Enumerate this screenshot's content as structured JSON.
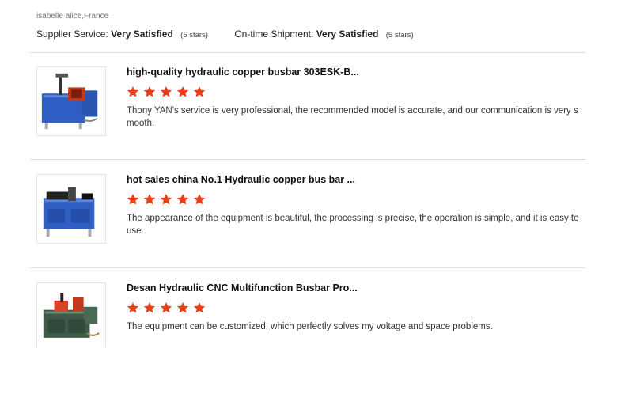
{
  "reviewer": "isabelle alice,France",
  "ratings": {
    "supplier_label": "Supplier Service:",
    "supplier_value": "Very Satisfied",
    "supplier_stars": "(5 stars)",
    "shipment_label": "On-time Shipment:",
    "shipment_value": "Very Satisfied",
    "shipment_stars": "(5 stars)"
  },
  "colors": {
    "star": "#e8411a",
    "divider": "#dedede"
  },
  "reviews": [
    {
      "title": "high-quality hydraulic copper busbar 303ESK-B...",
      "rating": 5,
      "comment": "Thony YAN's service is very professional, the recommended model is accurate, and our communication is very smooth.",
      "image_icon": "blue-busbar-machine-photo"
    },
    {
      "title": "hot sales china No.1 Hydraulic copper bus bar ...",
      "rating": 5,
      "comment": "The appearance of the equipment is beautiful, the processing is precise, the operation is simple, and it is easy to use.",
      "image_icon": "blue-busbar-machine-photo"
    },
    {
      "title": "Desan Hydraulic CNC Multifunction Busbar Pro...",
      "rating": 5,
      "comment": "The equipment can be customized, which perfectly solves my voltage and space problems.",
      "image_icon": "green-busbar-machine-photo"
    }
  ]
}
